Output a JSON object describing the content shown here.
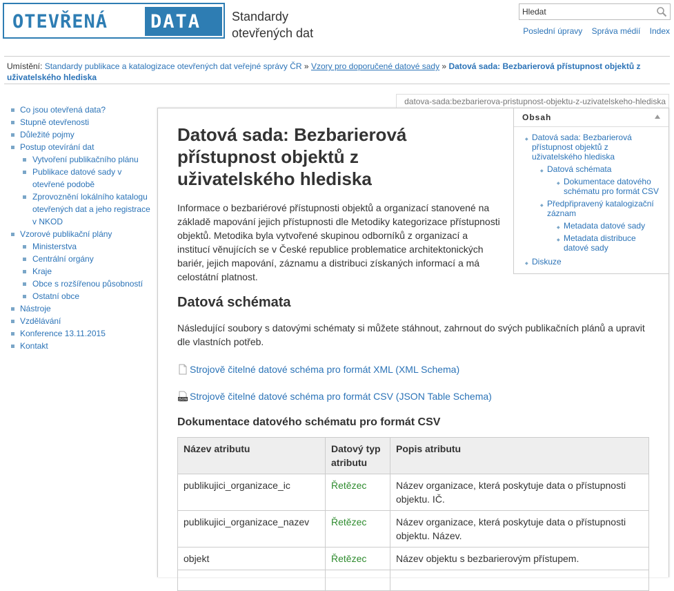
{
  "header": {
    "logo_open": "OTEVŘENÁ",
    "logo_data": "DATA",
    "site_title": "Standardy otevřených dat",
    "search_placeholder": "Hledat",
    "tools": [
      "Poslední úpravy",
      "Správa médií",
      "Index"
    ]
  },
  "breadcrumb": {
    "label": "Umístění:",
    "items": [
      "Standardy publikace a katalogizace otevřených dat veřejné správy ČR",
      "Vzory pro doporučené datové sady",
      "Datová sada: Bezbarierová přístupnost objektů z uživatelského hlediska"
    ],
    "separator": "»"
  },
  "sidebar": {
    "items": [
      {
        "label": "Co jsou otevřená data?"
      },
      {
        "label": "Stupně otevřenosti"
      },
      {
        "label": "Důležité pojmy"
      },
      {
        "label": "Postup otevírání dat",
        "children": [
          "Vytvoření publikačního plánu",
          "Publikace datové sady v otevřené podobě",
          "Zprovoznění lokálního katalogu otevřených dat a jeho registrace v NKOD"
        ]
      },
      {
        "label": "Vzorové publikační plány",
        "children": [
          "Ministerstva",
          "Centrální orgány",
          "Kraje",
          "Obce s rozšířenou působností",
          "Ostatní obce"
        ]
      },
      {
        "label": "Nástroje"
      },
      {
        "label": "Vzdělávání"
      },
      {
        "label": "Konference 13.11.2015"
      },
      {
        "label": "Kontakt"
      }
    ]
  },
  "page_id": "datova-sada:bezbarierova-pristupnost-objektu-z-uzivatelskeho-hlediska",
  "toc": {
    "title": "Obsah",
    "items": [
      {
        "label": "Datová sada: Bezbarierová přístupnost objektů z uživatelského hlediska"
      },
      {
        "label": "Datová schémata",
        "level": 2
      },
      {
        "label": "Dokumentace datového schématu pro formát CSV",
        "level": 3
      },
      {
        "label": "Předpřipravený katalogizační záznam",
        "level": 2
      },
      {
        "label": "Metadata datové sady",
        "level": 3
      },
      {
        "label": "Metadata distribuce datové sady",
        "level": 3
      },
      {
        "label": "Diskuze"
      }
    ]
  },
  "main": {
    "title": "Datová sada: Bezbarierová přístupnost objektů z uživatelského hlediska",
    "intro": "Informace o bezbariérové přístupnosti objektů a organizací stanovené na základě mapování jejich přístupnosti dle Metodiky kategorizace přístupnosti objektů. Metodika byla vytvořené skupinou odborníků z organizací a institucí věnujících se v České republice problematice architektonických bariér, jejich mapování, záznamu a distribuci získaných informací a má celostátní platnost.",
    "schemas_heading": "Datová schémata",
    "schemas_intro": "Následující soubory s datovými schématy si můžete stáhnout, zahrnout do svých publikačních plánů a upravit dle vlastních potřeb.",
    "files": [
      {
        "label": "Strojově čitelné datové schéma pro formát XML (XML Schema)",
        "icon": "document-icon"
      },
      {
        "label": "Strojově čitelné datové schéma pro formát CSV (JSON Table Schema)",
        "icon": "json-icon"
      }
    ],
    "csv_heading": "Dokumentace datového schématu pro formát CSV",
    "table": {
      "headers": [
        "Název atributu",
        "Datový typ atributu",
        "Popis atributu"
      ],
      "rows": [
        [
          "publikujici_organizace_ic",
          "Řetězec",
          "Název organizace, která poskytuje data o přístupnosti objektu. IČ."
        ],
        [
          "publikujici_organizace_nazev",
          "Řetězec",
          "Název organizace, která poskytuje data o přístupnosti objektu. Název."
        ],
        [
          "objekt",
          "Řetězec",
          "Název objektu s bezbarierovým přístupem."
        ],
        [
          "",
          "",
          ""
        ]
      ]
    }
  }
}
